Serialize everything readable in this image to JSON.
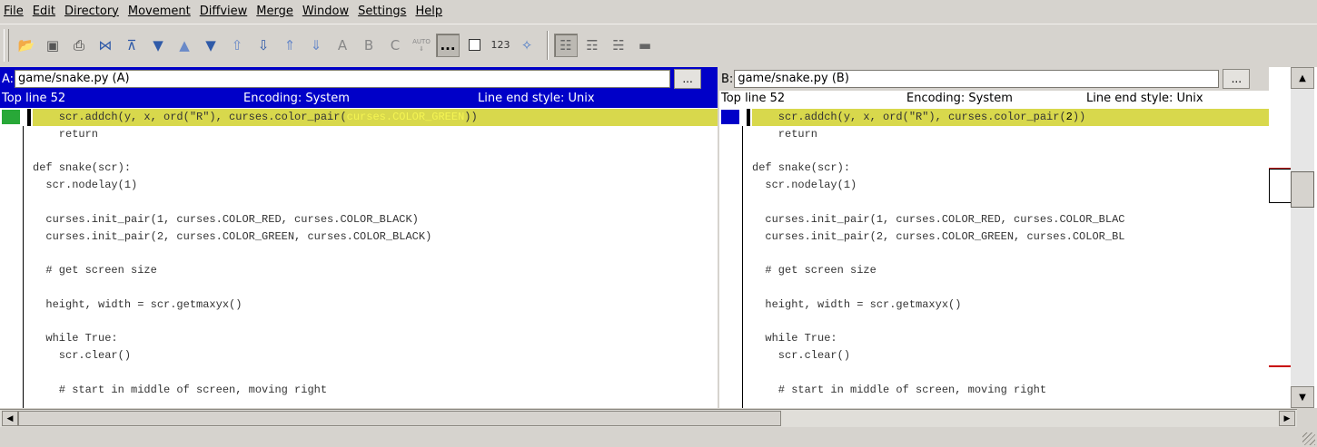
{
  "menu": [
    "File",
    "Edit",
    "Directory",
    "Movement",
    "Diffview",
    "Merge",
    "Window",
    "Settings",
    "Help"
  ],
  "toolbar": {
    "icons": [
      "open-folder-icon",
      "save-icon",
      "print-icon",
      "start-merge-icon",
      "go-top-icon",
      "go-bottom-icon",
      "go-prev-delta-icon",
      "go-next-delta-icon",
      "go-prev-conflict-icon",
      "go-next-conflict-icon",
      "go-prev-unsolved-icon",
      "go-next-unsolved-icon"
    ],
    "letters": [
      "A",
      "B",
      "C"
    ],
    "auto_label": "AUTO",
    "show_whitespace": "...",
    "line_numbers": "123"
  },
  "pane_a": {
    "prefix": "A:",
    "path": "game/snake.py (A)",
    "browse": "...",
    "top_line": "Top line 52",
    "encoding": "Encoding: System",
    "line_end": "Line end style: Unix",
    "diff_line_before": "    scr.addch(y, x, ord(\"R\"), curses.color_pair(",
    "diff_line_hl": "curses.COLOR_GREEN",
    "diff_line_after": "))",
    "lines": [
      "    return",
      "",
      "def snake(scr):",
      "  scr.nodelay(1)",
      "",
      "  curses.init_pair(1, curses.COLOR_RED, curses.COLOR_BLACK)",
      "  curses.init_pair(2, curses.COLOR_GREEN, curses.COLOR_BLACK)",
      "",
      "  # get screen size",
      "",
      "  height, width = scr.getmaxyx()",
      "",
      "  while True:",
      "    scr.clear()",
      "",
      "    # start in middle of screen, moving right"
    ]
  },
  "pane_b": {
    "prefix": "B:",
    "path": "game/snake.py (B)",
    "browse": "...",
    "top_line": "Top line 52",
    "encoding": "Encoding: System",
    "line_end": "Line end style: Unix",
    "diff_line_before": "    scr.addch(y, x, ord(\"R\"), curses.color_pair(",
    "diff_line_hl": "2",
    "diff_line_after": "))",
    "lines": [
      "    return",
      "",
      "def snake(scr):",
      "  scr.nodelay(1)",
      "",
      "  curses.init_pair(1, curses.COLOR_RED, curses.COLOR_BLAC",
      "  curses.init_pair(2, curses.COLOR_GREEN, curses.COLOR_BL",
      "",
      "  # get screen size",
      "",
      "  height, width = scr.getmaxyx()",
      "",
      "  while True:",
      "    scr.clear()",
      "",
      "    # start in middle of screen, moving right"
    ]
  },
  "colors": {
    "active_bar": "#0000c8",
    "diff_bg": "#d8d84c",
    "change_mark_a": "#28a838",
    "change_mark_b": "#0000c8",
    "overview_mark": "#c80000"
  }
}
